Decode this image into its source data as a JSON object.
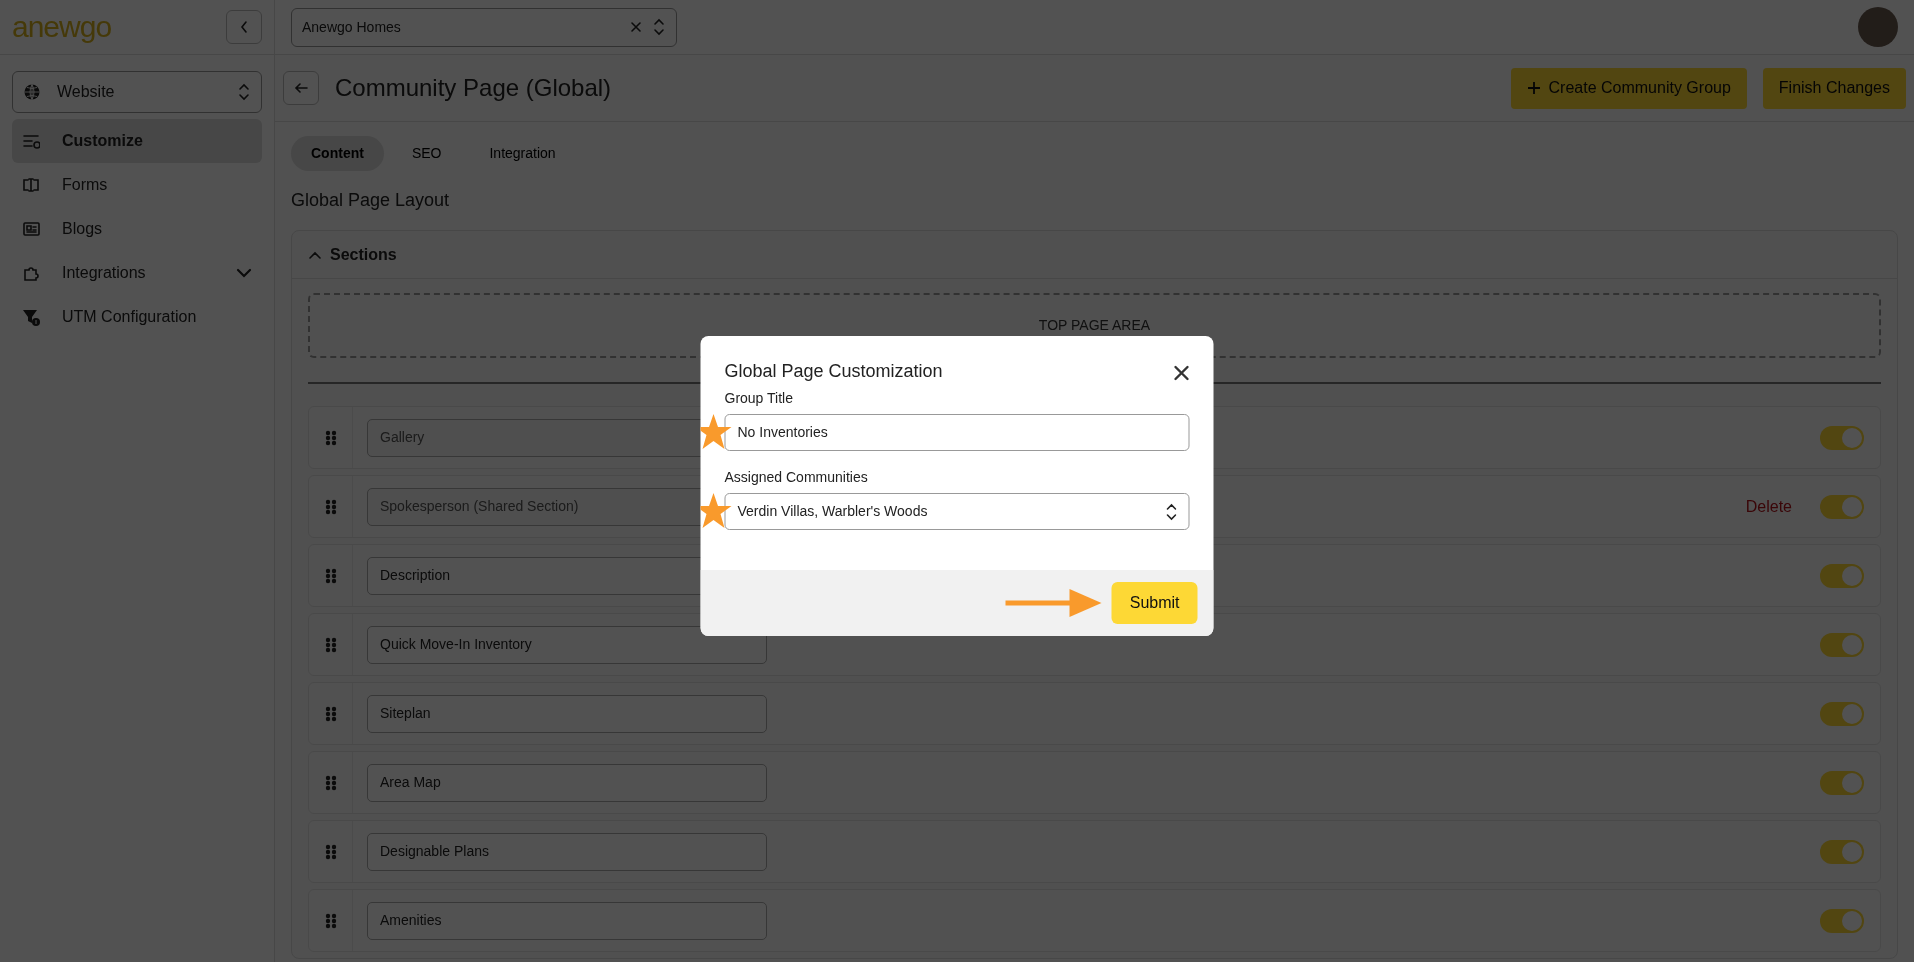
{
  "app": {
    "logo": "anewgo",
    "company_select": {
      "value": "Anewgo Homes"
    }
  },
  "sidebar": {
    "product_select": {
      "value": "Website"
    },
    "items": [
      {
        "label": "Customize",
        "kind": "customize",
        "selected": true,
        "has_submenu": false
      },
      {
        "label": "Forms",
        "kind": "forms",
        "selected": false,
        "has_submenu": false
      },
      {
        "label": "Blogs",
        "kind": "blogs",
        "selected": false,
        "has_submenu": false
      },
      {
        "label": "Integrations",
        "kind": "integrations",
        "selected": false,
        "has_submenu": true
      },
      {
        "label": "UTM Configuration",
        "kind": "utm",
        "selected": false,
        "has_submenu": false
      }
    ]
  },
  "header": {
    "title": "Community Page (Global)",
    "buttons": [
      {
        "label": "Create Community Group",
        "kind": "add"
      },
      {
        "label": "Finish Changes",
        "kind": "plain"
      }
    ]
  },
  "tabs": [
    {
      "label": "Content",
      "selected": true
    },
    {
      "label": "SEO",
      "selected": false
    },
    {
      "label": "Integration",
      "selected": false
    }
  ],
  "layout": {
    "heading": "Global Page Layout",
    "sections": {
      "title": "Sections",
      "expanded": true,
      "top_area": "TOP PAGE AREA",
      "rows": [
        {
          "name": "Gallery",
          "disabled": true,
          "on": true
        },
        {
          "name": "Spokesperson (Shared Section)",
          "disabled": true,
          "on": true,
          "action": "Delete"
        },
        {
          "name": "Description",
          "disabled": false,
          "on": true
        },
        {
          "name": "Quick Move-In Inventory",
          "disabled": false,
          "on": true
        },
        {
          "name": "Siteplan",
          "disabled": false,
          "on": true
        },
        {
          "name": "Area Map",
          "disabled": false,
          "on": true
        },
        {
          "name": "Designable Plans",
          "disabled": false,
          "on": true
        },
        {
          "name": "Amenities",
          "disabled": false,
          "on": true
        }
      ]
    }
  },
  "modal": {
    "title": "Global Page Customization",
    "fields": [
      {
        "label": "Group Title",
        "kind": "text",
        "value": "No Inventories",
        "starred": true
      },
      {
        "label": "Assigned Communities",
        "kind": "select",
        "value": "Verdin Villas, Warbler's Woods",
        "starred": true
      }
    ],
    "submit": {
      "label": "Submit",
      "arrow": true
    }
  }
}
